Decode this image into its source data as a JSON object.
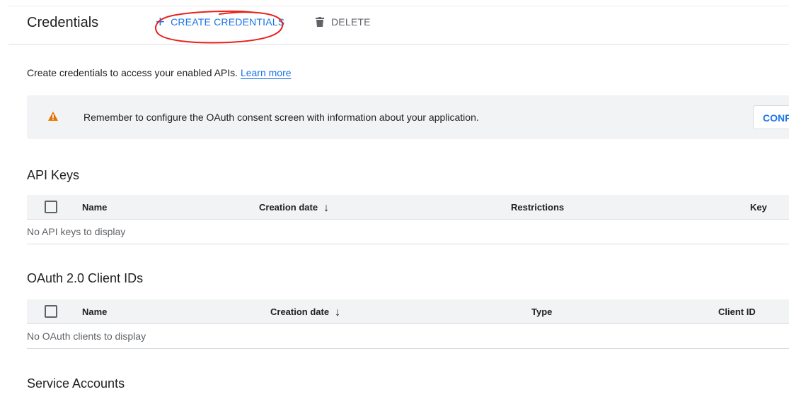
{
  "header": {
    "title": "Credentials",
    "create_label": "CREATE CREDENTIALS",
    "delete_label": "DELETE"
  },
  "intro": {
    "text": "Create credentials to access your enabled APIs.",
    "link": "Learn more"
  },
  "banner": {
    "message": "Remember to configure the OAuth consent screen with information about your application.",
    "button_label": "CONFIGURE CONSENT SCREEN"
  },
  "api_keys": {
    "title": "API Keys",
    "columns": [
      "Name",
      "Creation date",
      "Restrictions",
      "Key"
    ],
    "empty": "No API keys to display"
  },
  "oauth": {
    "title": "OAuth 2.0 Client IDs",
    "columns": [
      "Name",
      "Creation date",
      "Type",
      "Client ID"
    ],
    "empty": "No OAuth clients to display"
  },
  "service_accounts": {
    "title": "Service Accounts"
  },
  "colors": {
    "accent": "#1a73e8",
    "warning": "#e37400",
    "annotation": "#e8201a"
  }
}
